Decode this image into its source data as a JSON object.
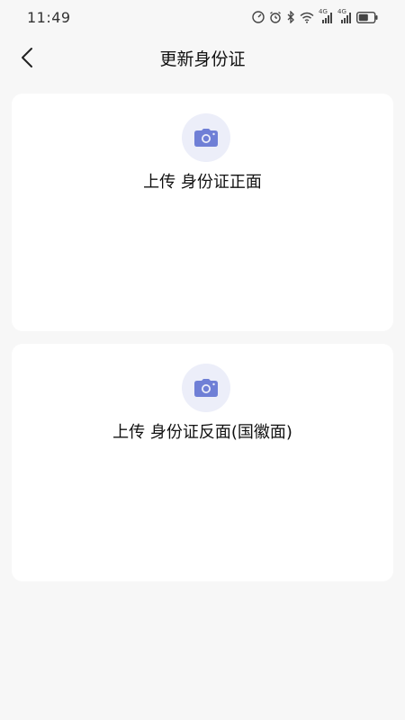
{
  "status_bar": {
    "time": "11:49",
    "network_label_1": "4G",
    "network_label_2": "4G"
  },
  "header": {
    "title": "更新身份证"
  },
  "cards": [
    {
      "label": "上传 身份证正面"
    },
    {
      "label": "上传 身份证反面(国徽面)"
    }
  ],
  "colors": {
    "background": "#f7f7f7",
    "card": "#ffffff",
    "icon_accent": "#6f7fd6",
    "icon_bg": "#eceef9"
  },
  "icons": {
    "back": "chevron-left-icon",
    "camera": "camera-icon"
  }
}
